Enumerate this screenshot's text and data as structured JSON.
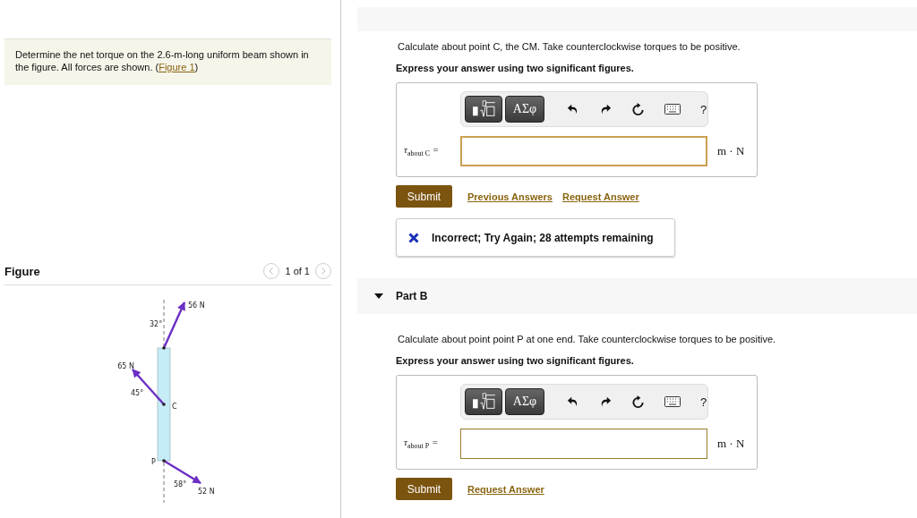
{
  "problem": {
    "text": "Determine the net torque on the 2.6-m-long uniform beam shown in the figure. All forces are shown. (",
    "link": "Figure 1",
    "after": ")"
  },
  "figure": {
    "title": "Figure",
    "pager": "1 of 1",
    "forces": [
      {
        "magnitude": "56 N",
        "angle": "32°"
      },
      {
        "magnitude": "65 N",
        "angle": "45°"
      },
      {
        "magnitude": "52 N",
        "angle": "58°"
      }
    ],
    "points": [
      "C",
      "P"
    ]
  },
  "parts": [
    {
      "prompt": "Calculate about point C, the CM. Take counterclockwise torques to be positive.",
      "instruction": "Express your answer using two significant figures.",
      "toolbar": {
        "symbols": "ΑΣφ",
        "help": "?"
      },
      "label": "τ$_{about C}$ =",
      "unit": "m · N",
      "submit": "Submit",
      "links": [
        "Previous Answers",
        "Request Answer"
      ],
      "feedback": {
        "correct": false,
        "text": "Incorrect; Try Again; 28 attempts remaining"
      }
    },
    {
      "title": "Part B",
      "expanded": true,
      "prompt": "Calculate about point point P at one end. Take counterclockwise torques to be positive.",
      "instruction": "Express your answer using two significant figures.",
      "toolbar": {
        "symbols": "ΑΣφ",
        "help": "?"
      },
      "label": "τ$_{about P}$ =",
      "unit": "m · N",
      "submit": "Submit",
      "links": [
        "Request Answer"
      ]
    }
  ]
}
